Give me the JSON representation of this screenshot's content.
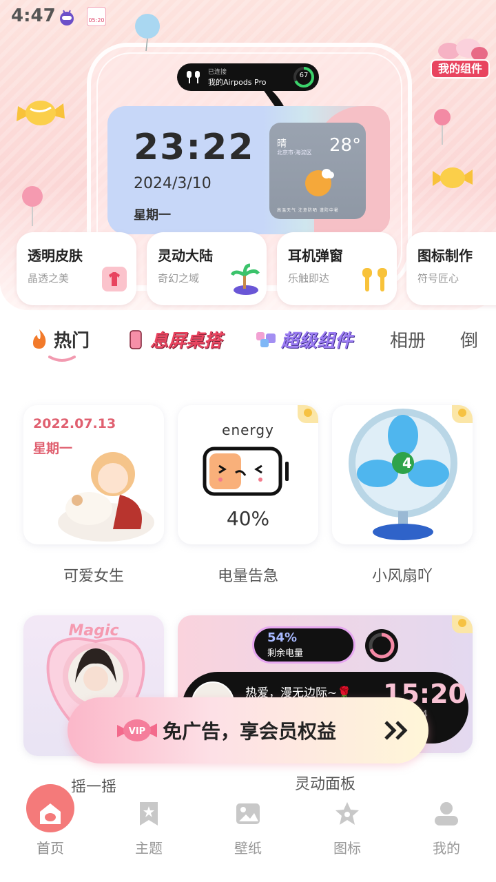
{
  "status_bar": {
    "time": "4:47",
    "notif_text": "05:20"
  },
  "hero": {
    "my_widget_btn": "我的组件",
    "island": {
      "status": "已连接",
      "device": "我的Airpods Pro",
      "battery": "67"
    },
    "clock": {
      "time": "23:22",
      "date": "2024/3/10",
      "weekday": "星期一"
    },
    "weather": {
      "condition": "晴",
      "location": "北京市·海淀区",
      "temp": "28°",
      "footer": "高温天气 注意防晒 谨防中暑"
    }
  },
  "features": [
    {
      "title": "透明皮肤",
      "subtitle": "晶透之美",
      "icon": "shirt-icon"
    },
    {
      "title": "灵动大陆",
      "subtitle": "奇幻之域",
      "icon": "palm-island-icon"
    },
    {
      "title": "耳机弹窗",
      "subtitle": "乐触即达",
      "icon": "earbuds-icon"
    },
    {
      "title": "图标制作",
      "subtitle": "符号匠心",
      "icon": "pen-icon"
    }
  ],
  "tabs": [
    {
      "label": "热门",
      "active": true
    },
    {
      "label": "息屏桌搭"
    },
    {
      "label": "超级组件"
    },
    {
      "label": "相册"
    },
    {
      "label": "倒"
    }
  ],
  "cards": [
    {
      "label": "可爱女生",
      "date": "2022.07.13",
      "weekday": "星期一"
    },
    {
      "label": "电量告急",
      "title": "energy",
      "percent": "40%"
    },
    {
      "label": "小风扇吖",
      "fan_speed": "4"
    },
    {
      "label": "摇一摇",
      "magic": "Magic"
    },
    {
      "label": "灵动面板",
      "battery_pct": "54%",
      "battery_label": "剩余电量",
      "quote": "热爱，漫无边际~🌹",
      "time": "15:20",
      "sub": "4"
    }
  ],
  "promo": {
    "text": "免广告，享会员权益",
    "badge": "VIP"
  },
  "bottom_nav": [
    {
      "label": "首页",
      "icon": "candy-home-icon",
      "active": true
    },
    {
      "label": "主题",
      "icon": "bookmark-star-icon"
    },
    {
      "label": "壁纸",
      "icon": "image-icon"
    },
    {
      "label": "图标",
      "icon": "star-icon"
    },
    {
      "label": "我的",
      "icon": "person-icon"
    }
  ],
  "colors": {
    "accent": "#e8445f",
    "home_active": "#f47a7a",
    "promo_from": "#fbb7c9",
    "promo_to": "#fff6d8"
  }
}
